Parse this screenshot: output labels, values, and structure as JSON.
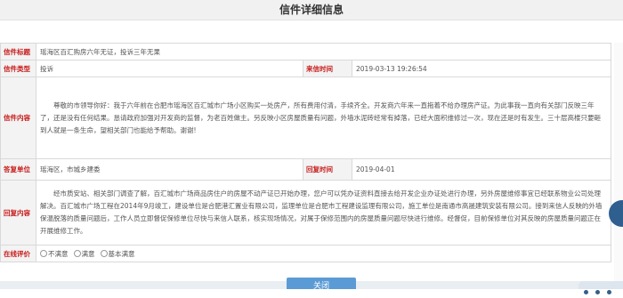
{
  "page": {
    "title": "信件详细信息"
  },
  "letter": {
    "title_label": "信件标题",
    "title_value": "瑶海区百汇购房六年无证，投诉三年无果",
    "type_label": "信件类型",
    "type_value": "投诉",
    "time_label": "来信时间",
    "time_value": "2019-03-13 19:26:54",
    "content_label": "信件内容",
    "content_value": "尊敬的市领导你好：我于六年前在合肥市瑶海区百汇城市广场小区购买一处房产，所有费用付清，手续齐全。开发商六年来一直拖着不给办理房产证。为此事我一直向有关部门反映三年了，还是没有任何结果。恳请政府加强对开发商的监督，为老百姓做主。另反映小区房屋质量有问题，外墙水泥砖经常有掉落，已经大面积维修过一次，现在还是时有发生。三十层高楼只要砸到人就是一条生命，望相关部门也能给予帮助。谢谢!"
  },
  "reply": {
    "unit_label": "答复单位",
    "unit_value": "瑶海区，市城乡建委",
    "time_label": "回复时间",
    "time_value": "2019-04-01",
    "content_label": "回复内容",
    "content_value": "经市质安站、相关部门调查了解，百汇城市广场商品房住户的房屋不动产证已开始办理，您户可以凭办证资料直接去给开发企业办证处进行办理，另外房屋维修事宜已经联系物业公司处理解决。百汇城市广场工程在2014年9月竣工，建设单位是合肥港汇置业有限公司，监理单位是合肥市工程建设监理有限公司，施工单位是南通市高晟建筑安装有限公司。接到来信人反映的外墙保温脱落的质量问题后，工作人员立即督促保修单位尽快与来信人联系，核实现场情况，对属于保修范围内的房屋质量问题尽快进行维修。经督促，目前保修单位对其反映的房屋质量问题正在开展维修工作。"
  },
  "evaluation": {
    "label": "在线评价",
    "options": [
      "不满意",
      "满意",
      "基本满意"
    ]
  },
  "actions": {
    "close_label": "关闭"
  }
}
